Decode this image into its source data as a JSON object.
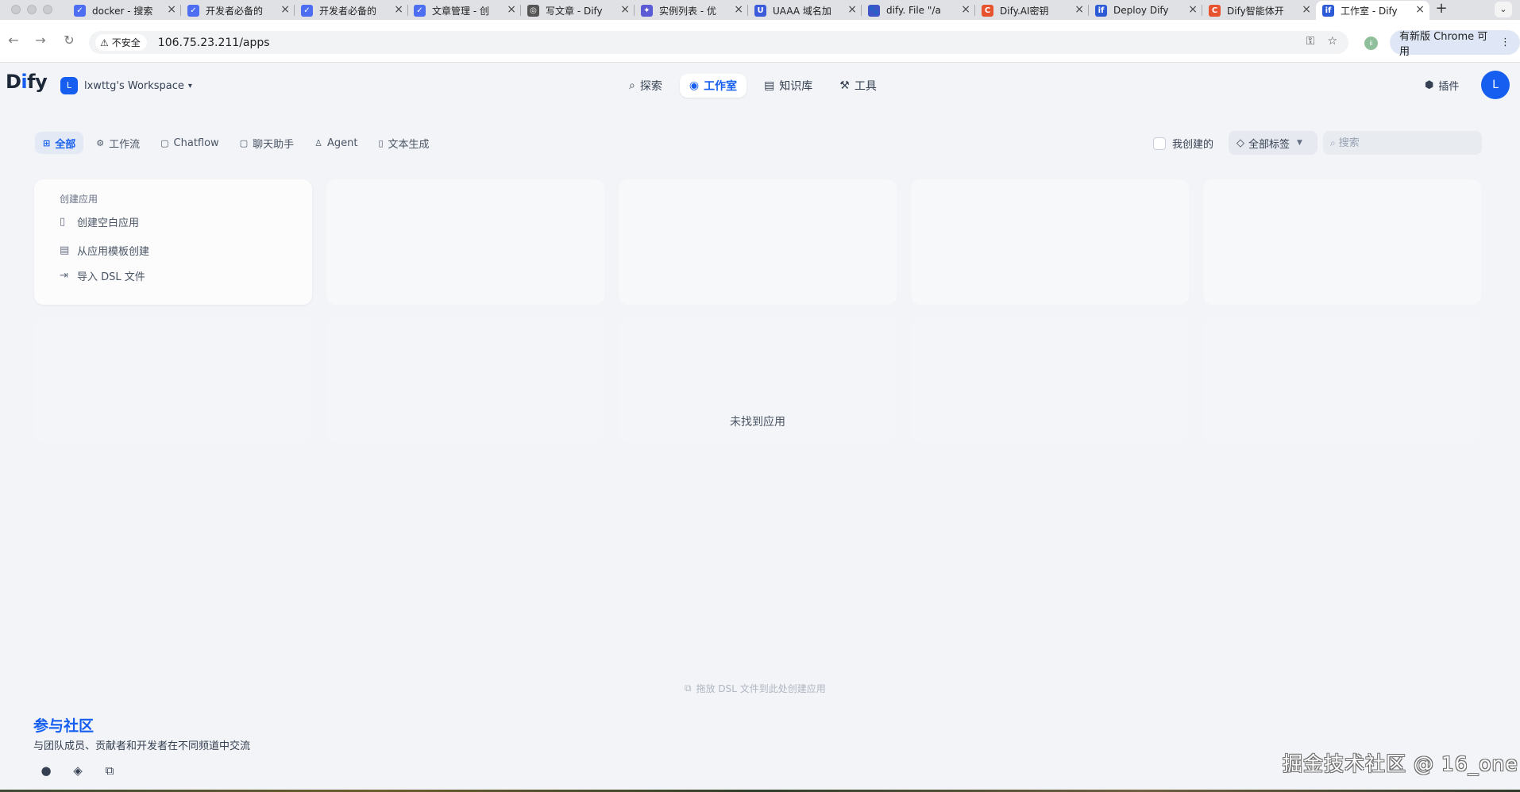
{
  "browser": {
    "tabs": [
      {
        "title": "docker - 搜索",
        "color": "#4e6ef2",
        "glyph": "✓"
      },
      {
        "title": "开发者必备的",
        "color": "#4e6ef2",
        "glyph": "✓"
      },
      {
        "title": "开发者必备的",
        "color": "#4e6ef2",
        "glyph": "✓"
      },
      {
        "title": "文章管理 - 创",
        "color": "#4e6ef2",
        "glyph": "✓"
      },
      {
        "title": "写文章 - Dify",
        "color": "#555555",
        "glyph": "◎"
      },
      {
        "title": "实例列表 - 优",
        "color": "#5b5bd6",
        "glyph": "✦"
      },
      {
        "title": "UAAA 域名加",
        "color": "#3b5bdb",
        "glyph": "U"
      },
      {
        "title": "dify. File \"/a",
        "color": "#3d55c9",
        "glyph": "🐾"
      },
      {
        "title": "Dify.AI密钥",
        "color": "#e8532f",
        "glyph": "C"
      },
      {
        "title": "Deploy Dify",
        "color": "#2d5bd6",
        "glyph": "if"
      },
      {
        "title": "Dify智能体开",
        "color": "#e8532f",
        "glyph": "C"
      },
      {
        "title": "工作室 - Dify",
        "color": "#2d5bd6",
        "glyph": "if"
      }
    ],
    "new_tab": "+",
    "tab_menu": "⌄",
    "security_label": "不安全",
    "url": "106.75.23.211/apps",
    "update_label": "有新版 Chrome 可用",
    "profile_initial": "ii"
  },
  "app": {
    "logo_pre": "D",
    "logo_i": "i",
    "logo_post": "fy",
    "workspace": {
      "initial": "L",
      "name": "lxwttg's Workspace"
    },
    "nav": [
      {
        "label": "探索",
        "icon": "compass-icon",
        "glyph": "⌕"
      },
      {
        "label": "工作室",
        "icon": "robot-icon",
        "glyph": "◉"
      },
      {
        "label": "知识库",
        "icon": "book-icon",
        "glyph": "▤"
      },
      {
        "label": "工具",
        "icon": "hammer-icon",
        "glyph": "⚒"
      }
    ],
    "active_nav": "工作室",
    "plugin_label": "插件",
    "user_initial": "L"
  },
  "filters": {
    "chips": [
      {
        "label": "全部",
        "icon": "grid-icon",
        "glyph": "⊞"
      },
      {
        "label": "工作流",
        "icon": "workflow-icon",
        "glyph": "⚙"
      },
      {
        "label": "Chatflow",
        "icon": "chat-flow-icon",
        "glyph": "▢"
      },
      {
        "label": "聊天助手",
        "icon": "chat-icon",
        "glyph": "▢"
      },
      {
        "label": "Agent",
        "icon": "agent-icon",
        "glyph": "♙"
      },
      {
        "label": "文本生成",
        "icon": "doc-icon",
        "glyph": "▯"
      }
    ],
    "active": "全部",
    "mine_label": "我创建的",
    "tag_label": "全部标签",
    "search_placeholder": "搜索"
  },
  "create": {
    "title": "创建应用",
    "options": [
      {
        "label": "创建空白应用",
        "icon": "blank-file-icon",
        "glyph": "▯"
      },
      {
        "label": "从应用模板创建",
        "icon": "template-icon",
        "glyph": "▤"
      },
      {
        "label": "导入 DSL 文件",
        "icon": "import-icon",
        "glyph": "⇥"
      }
    ]
  },
  "empty_message": "未找到应用",
  "drop_hint": "拖放 DSL 文件到此处创建应用",
  "community": {
    "title": "参与社区",
    "description": "与团队成员、贡献者和开发者在不同频道中交流"
  },
  "watermark": "掘金技术社区 @ 16_one"
}
